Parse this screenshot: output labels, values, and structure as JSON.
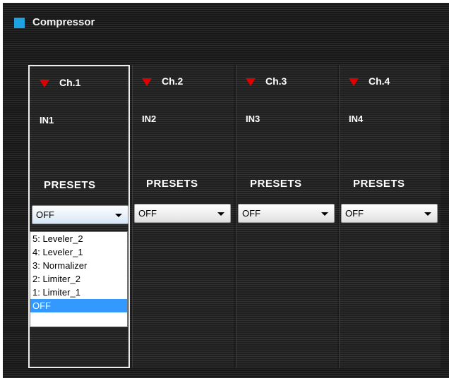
{
  "window": {
    "title": "Compressor",
    "icon": "square-icon",
    "accent": "#1fa3e0"
  },
  "channels": [
    {
      "title": "Ch.1",
      "input": "IN1",
      "presets_label": "PRESETS",
      "preset_value": "OFF"
    },
    {
      "title": "Ch.2",
      "input": "IN2",
      "presets_label": "PRESETS",
      "preset_value": "OFF"
    },
    {
      "title": "Ch.3",
      "input": "IN3",
      "presets_label": "PRESETS",
      "preset_value": "OFF"
    },
    {
      "title": "Ch.4",
      "input": "IN4",
      "presets_label": "PRESETS",
      "preset_value": "OFF"
    }
  ],
  "dropdown": {
    "options": [
      "5: Leveler_2",
      "4: Leveler_1",
      "3: Normalizer",
      "2: Limiter_2",
      "1: Limiter_1",
      "OFF"
    ],
    "highlighted": "OFF"
  },
  "colors": {
    "triangle": "#e00000",
    "highlight": "#3399ff"
  }
}
